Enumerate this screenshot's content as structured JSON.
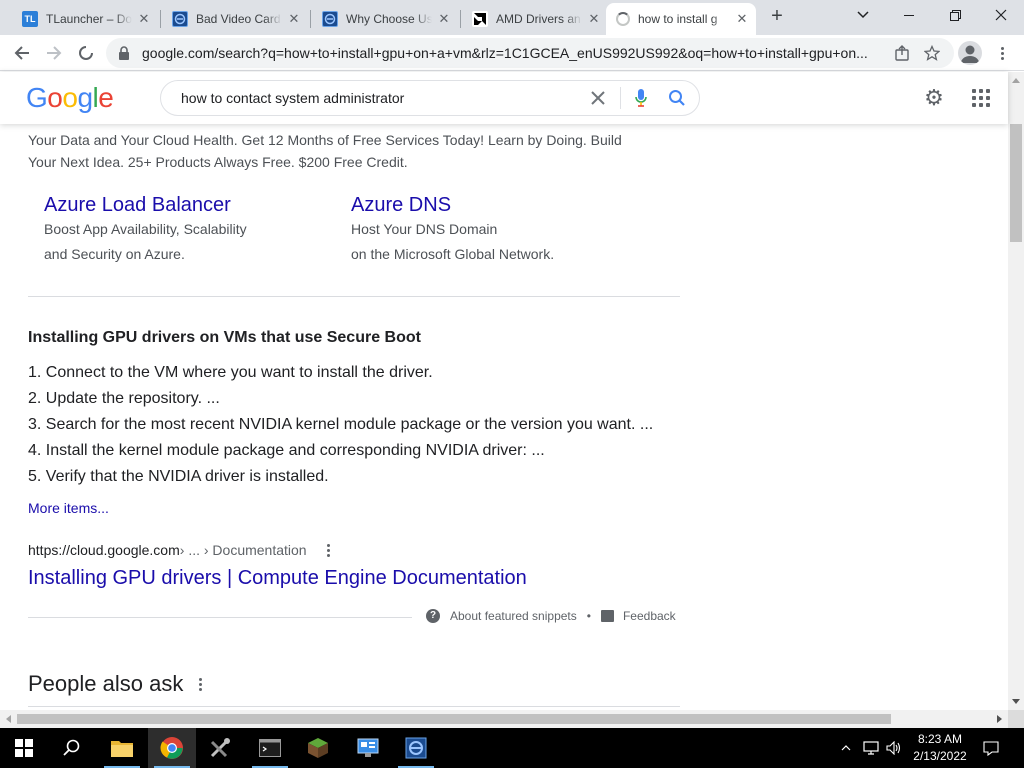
{
  "browser": {
    "tabs": [
      {
        "title": "TLauncher – Do",
        "favicon": "TL"
      },
      {
        "title": "Bad Video Card",
        "favicon": "edge-blue-icon"
      },
      {
        "title": "Why Choose Us",
        "favicon": "edge-blue-icon"
      },
      {
        "title": "AMD Drivers an",
        "favicon": "amd-logo-icon"
      },
      {
        "title": "how to install g",
        "favicon": "loading-spinner-icon"
      }
    ],
    "url": "google.com/search?q=how+to+install+gpu+on+a+vm&rlz=1C1GCEA_enUS992US992&oq=how+to+install+gpu+on..."
  },
  "google": {
    "logo": "Google",
    "query": "how to contact system administrator"
  },
  "ad": {
    "text": "Your Data and Your Cloud Health. Get 12 Months of Free Services Today! Learn by Doing. Build Your Next Idea. 25+ Products Always Free. $200 Free Credit.",
    "sitelinks": [
      {
        "title": "Azure Load Balancer",
        "line1": "Boost App Availability, Scalability",
        "line2": "and Security on Azure."
      },
      {
        "title": "Azure DNS",
        "line1": "Host Your DNS Domain",
        "line2": "on the Microsoft Global Network."
      }
    ]
  },
  "snippet": {
    "title": "Installing GPU drivers on VMs that use Secure Boot",
    "steps": [
      "1. Connect to the VM where you want to install the driver.",
      "2. Update the repository. ...",
      "3. Search for the most recent NVIDIA kernel module package or the version you want. ...",
      "4. Install the kernel module package and corresponding NVIDIA driver: ...",
      "5. Verify that the NVIDIA driver is installed."
    ],
    "more_items": "More items...",
    "cite_domain": "https://cloud.google.com",
    "cite_path": " › ... › Documentation",
    "result_title": "Installing GPU drivers | Compute Engine Documentation",
    "about_label": "About featured snippets",
    "separator": "•",
    "feedback_label": "Feedback"
  },
  "paa": {
    "title": "People also ask"
  },
  "taskbar": {
    "time": "8:23 AM",
    "date": "2/13/2022"
  },
  "colors": {
    "link": "#1a0dab",
    "google_blue": "#4285f4",
    "google_red": "#ea4335",
    "google_yellow": "#fbbc05",
    "google_green": "#34a853"
  }
}
